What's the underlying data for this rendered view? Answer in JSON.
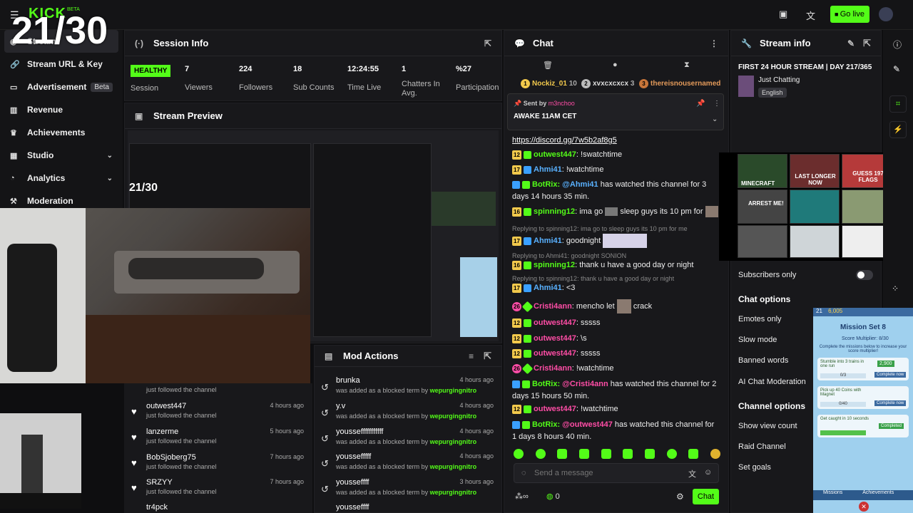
{
  "topbar": {
    "logo": "KICK",
    "logo_badge": "BETA",
    "go_live": "Go live"
  },
  "overlay_counter": "21/30",
  "sidebar": {
    "items": [
      {
        "label": "Stream"
      },
      {
        "label": "Stream URL & Key"
      },
      {
        "label": "Advertisement",
        "badge": "Beta"
      },
      {
        "label": "Revenue"
      },
      {
        "label": "Achievements"
      },
      {
        "label": "Studio"
      },
      {
        "label": "Analytics"
      },
      {
        "label": "Moderation"
      }
    ]
  },
  "session": {
    "title": "Session Info",
    "status": "HEALTHY",
    "status_label": "Session",
    "stats": [
      {
        "value": "7",
        "label": "Viewers"
      },
      {
        "value": "224",
        "label": "Followers"
      },
      {
        "value": "18",
        "label": "Sub Counts"
      },
      {
        "value": "12:24:55",
        "label": "Time Live"
      },
      {
        "value": "1",
        "label": "Chatters In Avg."
      },
      {
        "value": "%27",
        "label": "Participation"
      }
    ]
  },
  "preview": {
    "title": "Stream Preview"
  },
  "follows": [
    {
      "name": "",
      "status": "just followed the channel",
      "time": ""
    },
    {
      "name": "outwest447",
      "status": "just followed the channel",
      "time": "4 hours ago"
    },
    {
      "name": "lanzerme",
      "status": "just followed the channel",
      "time": "5 hours ago"
    },
    {
      "name": "BobSjoberg75",
      "status": "just followed the channel",
      "time": "7 hours ago"
    },
    {
      "name": "SRZYY",
      "status": "just followed the channel",
      "time": "7 hours ago"
    },
    {
      "name": "tr4pck",
      "status": "",
      "time": ""
    }
  ],
  "mod_actions": {
    "title": "Mod Actions",
    "items": [
      {
        "name": "brunka",
        "text": "was added as a blocked term by",
        "by": "wepurgingnitro",
        "time": "4 hours ago"
      },
      {
        "name": "y.v",
        "text": "was added as a blocked term by",
        "by": "wepurgingnitro",
        "time": "4 hours ago"
      },
      {
        "name": "youssefffffffffff",
        "text": "was added as a blocked term by",
        "by": "wepurgingnitro",
        "time": "4 hours ago"
      },
      {
        "name": "youssefffff",
        "text": "was added as a blocked term by",
        "by": "wepurgingnitro",
        "time": "4 hours ago"
      },
      {
        "name": "yousseffff",
        "text": "was added as a blocked term by",
        "by": "wepurgingnitro",
        "time": "3 hours ago"
      },
      {
        "name": "yousseffff",
        "text": "",
        "by": "",
        "time": ""
      }
    ]
  },
  "chat": {
    "title": "Chat",
    "top_chatters": [
      {
        "rank": "1",
        "name": "Nockiz_01",
        "count": "10"
      },
      {
        "rank": "2",
        "name": "xvxcxcxcx",
        "count": "3"
      },
      {
        "rank": "3",
        "name": "thereisnousernamedä",
        "count": ""
      }
    ],
    "pinned": {
      "sent_by_label": "Sent by",
      "sent_by": "m3nchoo",
      "message": "AWAKE 11AM CET"
    },
    "link": "https://discord.gg/7w5b2af8g5",
    "messages": [
      {
        "lvl": "12",
        "user": "outwest447",
        "text": "!swatchtime",
        "color": "green"
      },
      {
        "lvl": "17",
        "user": "Ahmi41",
        "text": "!watchtime",
        "color": "blue"
      },
      {
        "lvl": "",
        "user": "BotRix:",
        "mention": "@Ahmi41",
        "text": "has watched this channel for 3 days 14 hours 35 min.",
        "color": "green"
      },
      {
        "lvl": "16",
        "user": "spinning12",
        "text": "ima go",
        "text2": "sleep guys its 10 pm for",
        "color": "green"
      },
      {
        "reply": "Replying to spinning12: ima go to sleep guys its 10 pm for me"
      },
      {
        "lvl": "17",
        "user": "Ahmi41",
        "text": "goodnight",
        "color": "blue"
      },
      {
        "reply": "Replying to Ahmi41: goodnight SONION"
      },
      {
        "lvl": "16",
        "user": "spinning12",
        "text": "thank u have a good day or night",
        "color": "green"
      },
      {
        "reply": "Replying to spinning12: thank u have a good day or night"
      },
      {
        "lvl": "17",
        "user": "Ahmi41",
        "text": "<3",
        "color": "blue"
      },
      {
        "lvl": "26",
        "user": "Cristi4ann",
        "text": "mencho let",
        "text2": "crack",
        "color": "pink"
      },
      {
        "lvl": "12",
        "user": "outwest447",
        "text": "sssss",
        "color": "pink"
      },
      {
        "lvl": "12",
        "user": "outwest447",
        "text": "\\s",
        "color": "pink"
      },
      {
        "lvl": "12",
        "user": "outwest447",
        "text": "sssss",
        "color": "pink"
      },
      {
        "lvl": "26",
        "user": "Cristi4ann",
        "text": "!watchtime",
        "color": "pink"
      },
      {
        "lvl": "",
        "user": "BotRix:",
        "mention": "@Cristi4ann",
        "text": "has watched this channel for 2 days 15 hours 50 min.",
        "color": "green"
      },
      {
        "lvl": "12",
        "user": "outwest447",
        "text": "!watchtime",
        "color": "pink"
      },
      {
        "lvl": "",
        "user": "BotRix:",
        "mention": "@outwest447",
        "text": "has watched this channel for 1 days 8 hours 40 min.",
        "color": "green"
      }
    ],
    "input_placeholder": "Send a message",
    "viewers_count": "0",
    "send_label": "Chat"
  },
  "stream_info": {
    "title": "Stream info",
    "stream_title": "FIRST 24 HOUR STREAM | DAY 217/365",
    "category": "Just Chatting",
    "language": "English"
  },
  "chat_settings": {
    "subscribers_only": "Subscribers only",
    "chat_options_title": "Chat options",
    "chat_options": [
      "Emotes only",
      "Slow mode",
      "Banned words",
      "AI Chat Moderation"
    ],
    "channel_options_title": "Channel options",
    "channel_options": [
      "Show view count",
      "Raid Channel",
      "Set goals"
    ]
  },
  "thumbs": [
    "MINECRAFT",
    "LAST LONGER NOW",
    "GUESS 197 FLAGS",
    "ARREST ME!"
  ],
  "mission": {
    "title": "Mission Set 8",
    "score": "Score Multiplier: 8/30",
    "desc": "Complete the missions below to increase your score multiplier!",
    "coins": "6,005",
    "level": "21",
    "items": [
      {
        "text": "Stumble into 3 trains in one run",
        "progress": "0/3",
        "reward": "2,900",
        "btn": "Complete now"
      },
      {
        "text": "Pick up 40 Coins with Magnet",
        "progress": "0/40",
        "reward": "",
        "btn": "Complete now"
      },
      {
        "text": "Get caught in 10 seconds",
        "progress": "",
        "reward": "",
        "btn": "Completed"
      }
    ],
    "tabs": [
      "Missions",
      "Achievements"
    ]
  }
}
